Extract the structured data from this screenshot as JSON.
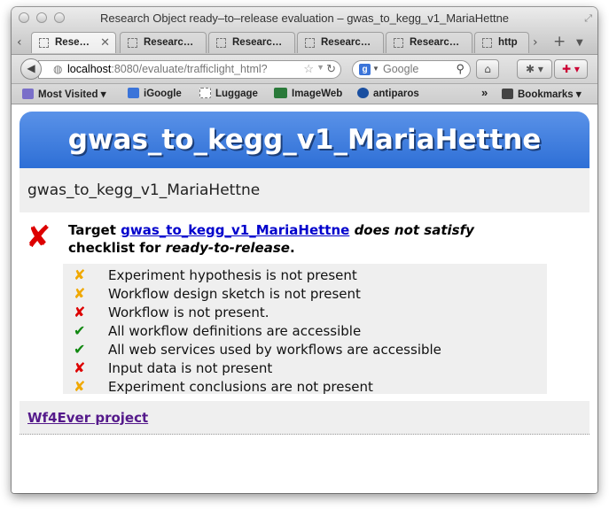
{
  "window": {
    "title": "Research Object ready–to–release evaluation – gwas_to_kegg_v1_MariaHettne"
  },
  "tabs": [
    {
      "label": "Rese…",
      "active": true
    },
    {
      "label": "Researc…",
      "active": false
    },
    {
      "label": "Researc…",
      "active": false
    },
    {
      "label": "Researc…",
      "active": false
    },
    {
      "label": "Researc…",
      "active": false
    },
    {
      "label": "http",
      "active": false
    }
  ],
  "nav": {
    "url_host": "localhost",
    "url_rest": ":8080/evaluate/trafficlight_html?",
    "search_engine": "Google",
    "search_placeholder": "Google",
    "back_icon": "back-arrow-icon",
    "home_icon": "home-icon"
  },
  "bookmarks": [
    {
      "label": "Most Visited ▾",
      "icon": "most-visited-icon",
      "color": "#6a5acd"
    },
    {
      "label": "iGoogle",
      "icon": "igoogle-icon",
      "color": "#3b74d9"
    },
    {
      "label": "Luggage",
      "icon": "page-icon",
      "color": "#ffffff"
    },
    {
      "label": "ImageWeb",
      "icon": "imageweb-icon",
      "color": "#2a7a3a"
    },
    {
      "label": "antiparos",
      "icon": "antiparos-icon",
      "color": "#1a4fa0"
    },
    {
      "label": "Bookmarks ▾",
      "icon": "bookmarks-icon",
      "color": "#444444"
    }
  ],
  "page": {
    "banner_title": "gwas_to_kegg_v1_MariaHettne",
    "subtitle": "gwas_to_kegg_v1_MariaHettne",
    "verdict_target_label": "Target",
    "verdict_link": "gwas_to_kegg_v1_MariaHettne",
    "verdict_status": "does not satisfy",
    "verdict_checklist_prefix": "checklist for",
    "verdict_purpose": "ready-to-release",
    "verdict_end": ".",
    "checklist": [
      {
        "status": "warn",
        "icon": "✘",
        "text": "Experiment hypothesis is not present"
      },
      {
        "status": "warn",
        "icon": "✘",
        "text": "Workflow design sketch is not present"
      },
      {
        "status": "fail",
        "icon": "✘",
        "text": "Workflow is not present."
      },
      {
        "status": "pass",
        "icon": "✔",
        "text": "All workflow definitions are accessible"
      },
      {
        "status": "pass",
        "icon": "✔",
        "text": "All web services used by workflows are accessible"
      },
      {
        "status": "fail",
        "icon": "✘",
        "text": "Input data is not present"
      },
      {
        "status": "warn",
        "icon": "✘",
        "text": "Experiment conclusions are not present"
      }
    ],
    "footer_link": "Wf4Ever project"
  },
  "colors": {
    "banner": "#2e6fd6",
    "fail": "#dd0000",
    "pass": "#118811",
    "warn": "#f0a800",
    "link": "#0000cc",
    "visited_link": "#551a8b"
  }
}
